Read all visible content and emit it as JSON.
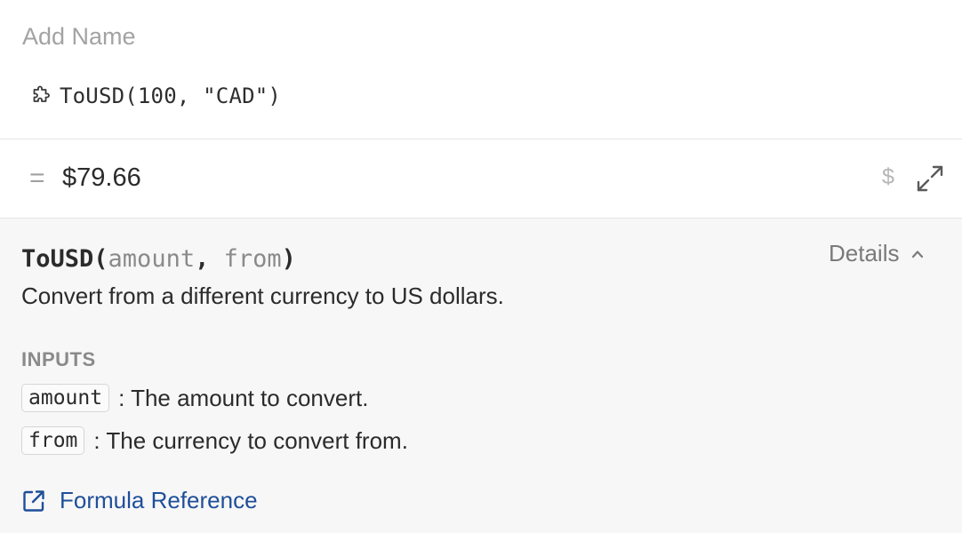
{
  "name_placeholder": "Add Name",
  "formula": "ToUSD(100, \"CAD\")",
  "result": {
    "equals": "=",
    "value": "$79.66",
    "format_symbol": "$"
  },
  "help": {
    "function_name": "ToUSD(",
    "params": [
      "amount",
      "from"
    ],
    "separator": ",",
    "close_paren": ")",
    "details_label": "Details",
    "description": "Convert from a different currency to US dollars.",
    "inputs_heading": "INPUTS",
    "inputs": [
      {
        "name": "amount",
        "desc": ": The amount to convert."
      },
      {
        "name": "from",
        "desc": ": The currency to convert from."
      }
    ],
    "reference_link": "Formula Reference"
  },
  "colors": {
    "link": "#1f4f9a",
    "muted": "#8a8a8a",
    "panel_bg": "#f7f7f7"
  }
}
